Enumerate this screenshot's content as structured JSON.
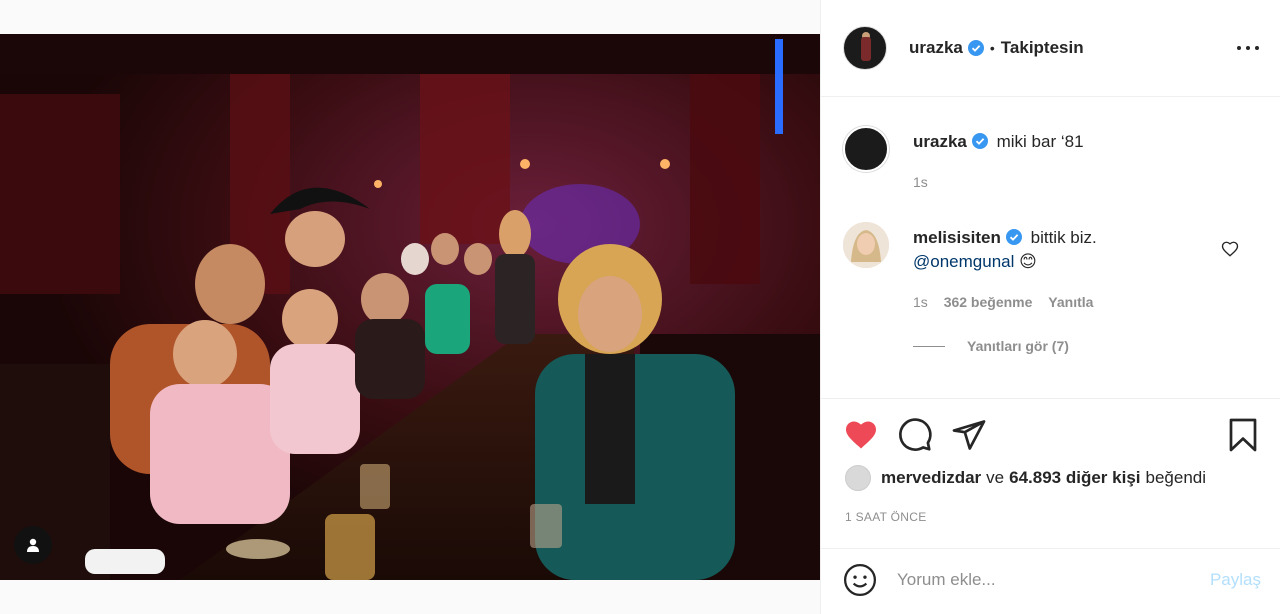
{
  "post": {
    "author": "urazka",
    "follow_status": "Takiptesin",
    "separator": "•"
  },
  "caption": {
    "author": "urazka",
    "text": "miki bar ‘81",
    "time": "1s"
  },
  "comment": {
    "author": "melisisiten",
    "text": "bittik biz.",
    "mention": "@onemgunal",
    "emoji": "😊",
    "time": "1s",
    "likes": "362 beğenme",
    "reply": "Yanıtla",
    "view_replies": "Yanıtları gör (7)"
  },
  "likes": {
    "user": "mervedizdar",
    "connector": "ve",
    "others": "64.893 diğer kişi",
    "suffix": "beğendi"
  },
  "post_time": "1 SAAT ÖNCE",
  "add_comment": {
    "placeholder": "Yorum ekle...",
    "post_label": "Paylaş"
  },
  "colors": {
    "like_red": "#ed4956",
    "verified_blue": "#3897f0",
    "link_blue": "#00376b",
    "post_disabled": "#b2dffc",
    "muted": "#8e8e8e"
  },
  "icons": {
    "more": "more-icon",
    "heart": "heart-icon",
    "comment": "comment-icon",
    "share": "share-icon",
    "save": "bookmark-icon",
    "emoji": "smiley-icon",
    "tag": "user-tag-icon"
  }
}
